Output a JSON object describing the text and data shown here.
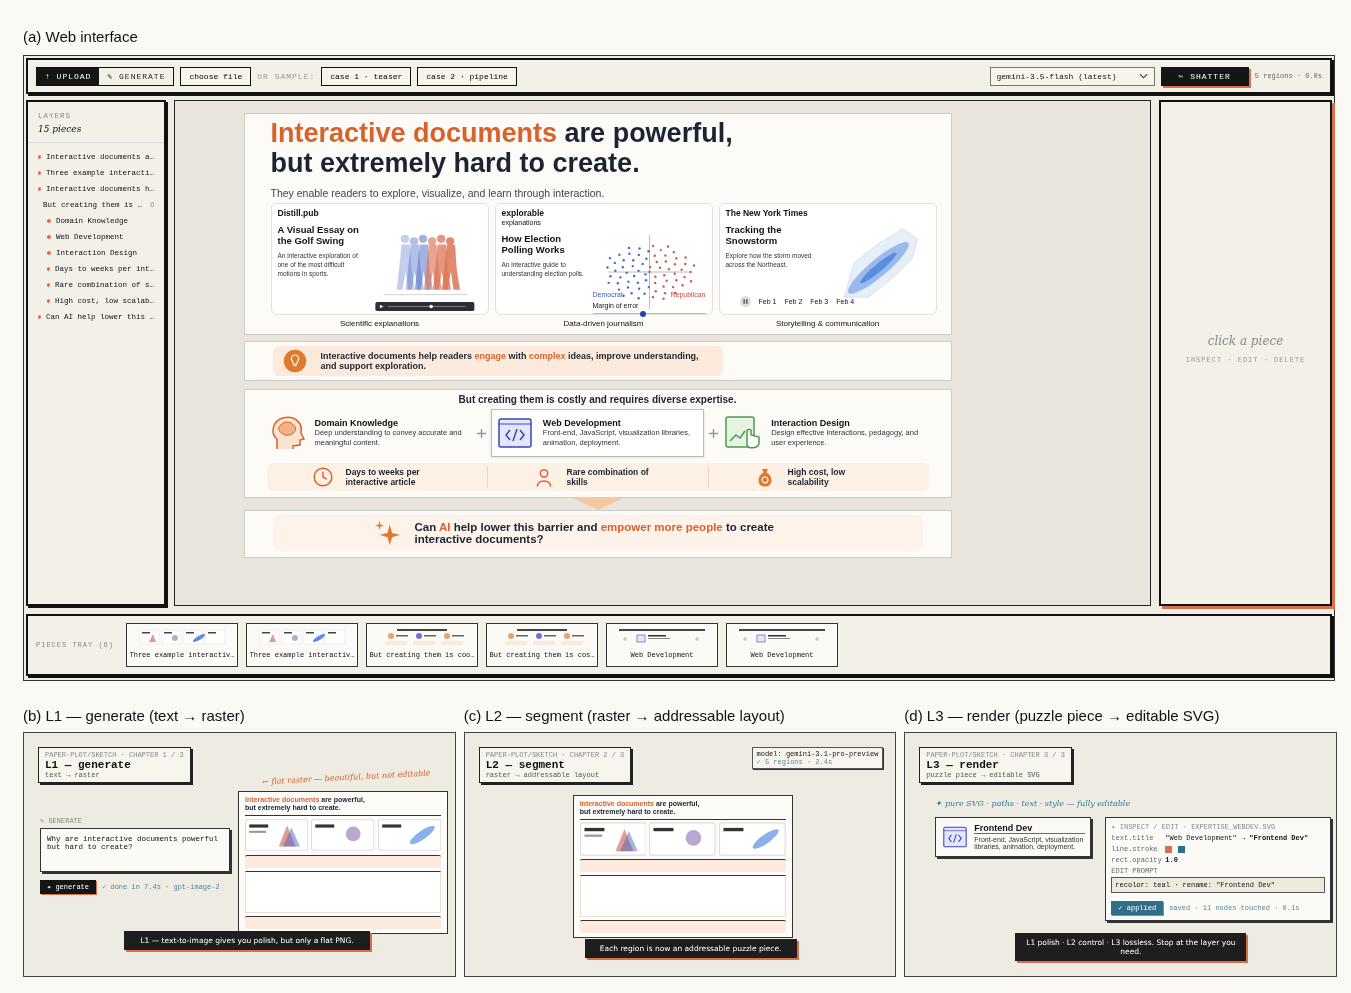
{
  "panel_a": {
    "caption": "(a) Web interface",
    "toolbar": {
      "modes": [
        {
          "label": "↑ UPLOAD",
          "selected": true
        },
        {
          "label": "✎ GENERATE",
          "selected": false
        }
      ],
      "file_button": "choose file",
      "sample_label": "OR SAMPLE:",
      "samples": [
        "case 1 · teaser",
        "case 2 · pipeline"
      ],
      "model_select": "gemini-3.5-flash (latest)",
      "shatter_button": "✂ SHATTER",
      "status": "5 regions · 0.0s"
    },
    "layers": {
      "title": "LAYERS",
      "count": "15 pieces",
      "items": [
        {
          "label": "Interactive documents a…"
        },
        {
          "label": "Three example interacti…"
        },
        {
          "label": "Interactive documents h…"
        },
        {
          "label": "But creating them is …",
          "badge": "6",
          "children": [
            {
              "label": "Domain Knowledge"
            },
            {
              "label": "Web Development"
            },
            {
              "label": "Interaction Design"
            },
            {
              "label": "Days to weeks per int…"
            },
            {
              "label": "Rare combination of s…"
            },
            {
              "label": "High cost, low scalab…"
            }
          ]
        },
        {
          "label": "Can AI help lower this …"
        }
      ]
    },
    "document": {
      "title_line1": [
        {
          "text": "Interactive documents",
          "accent": true
        },
        {
          "text": " are powerful,",
          "accent": false
        }
      ],
      "title_line2": "but extremely hard to create.",
      "subtitle": "They enable readers to explore, visualize, and learn through interaction.",
      "cards": [
        {
          "kind": "golf",
          "source": "Distill.pub",
          "title": "A Visual Essay on the Golf Swing",
          "desc": "An interactive exploration of one of the most difficult motions in sports.",
          "caption": "Scientific explanations"
        },
        {
          "kind": "poll",
          "source": "explorable",
          "source_sub": "explanations",
          "level": 0.45,
          "title": "How Election Polling Works",
          "desc": "An interactive guide to understanding election polls.",
          "labels": [
            "Democrat",
            "Republican",
            "Margin of error"
          ],
          "caption": "Data-driven journalism"
        },
        {
          "kind": "map",
          "source": "The New York Times",
          "title": "Tracking the Snowstorm",
          "desc": "Explore how the storm moved across the Northeast.",
          "labels": [
            "Feb 1",
            "Feb 2",
            "Feb 3",
            "Feb 4"
          ],
          "caption": "Storytelling & communication"
        }
      ],
      "engage": [
        {
          "text": "Interactive documents help readers ",
          "accent": false
        },
        {
          "text": "engage",
          "accent": true
        },
        {
          "text": " with ",
          "accent": false
        },
        {
          "text": "complex",
          "accent": true
        },
        {
          "text": " ideas, improve understanding, and support exploration.",
          "accent": false
        }
      ],
      "costs_heading": "But creating them is costly and requires diverse expertise.",
      "expertise": [
        {
          "kind": "brain",
          "title": "Domain Knowledge",
          "desc": "Deep understanding to convey accurate and meaningful content."
        },
        {
          "kind": "code",
          "title": "Web Development",
          "desc": "Front-end, JavaScript, visualization libraries, animation, deployment."
        },
        {
          "kind": "hand",
          "title": "Interaction Design",
          "desc": "Design effective interactions, pedagogy, and user experience."
        }
      ],
      "costs": [
        {
          "kind": "clock",
          "text": "Days to weeks per interactive article"
        },
        {
          "kind": "person",
          "text": "Rare combination of skills"
        },
        {
          "kind": "money",
          "text": "High cost, low scalability"
        }
      ],
      "question": [
        {
          "text": "Can ",
          "accent": false
        },
        {
          "text": "AI",
          "accent": true
        },
        {
          "text": " help lower this barrier and ",
          "accent": false
        },
        {
          "text": "empower more people",
          "accent": true
        },
        {
          "text": " to create interactive documents?",
          "accent": false
        }
      ]
    },
    "inspector": {
      "hint": "click a piece",
      "actions": "INSPECT · EDIT · DELETE"
    },
    "tray": {
      "label": "PIECES TRAY (6)",
      "pieces": [
        {
          "kind": "cards",
          "label": "Three example interactiv…"
        },
        {
          "kind": "cards",
          "label": "Three example interactiv…"
        },
        {
          "kind": "costs",
          "label": "But creating them is coo…"
        },
        {
          "kind": "costs",
          "label": "But creating them is cos…"
        },
        {
          "kind": "webdev",
          "label": "Web Development"
        },
        {
          "kind": "webdev",
          "label": "Web Development"
        }
      ]
    }
  },
  "panel_b": {
    "caption": "(b) L1 — generate (text → raster)",
    "chapter": {
      "kicker": "PAPER·PLOT/SKETCH · CHAPTER 1 / 3",
      "title": "L1 — generate",
      "sub": "text → raster"
    },
    "prompt_label": "✎ GENERATE",
    "prompt": "Why are interactive documents powerful but hard to create?",
    "button": "✦ generate",
    "status": "✓ done in 7.4s · gpt-image-2",
    "annotation": "← flat raster — beautiful, but not editable",
    "preview": {
      "title_line1": [
        {
          "text": "Interactive documents",
          "accent": true
        },
        {
          "text": " are powerful,",
          "accent": false
        }
      ],
      "title_line2": "but extremely hard to create."
    },
    "note": "L1 — text-to-image gives you polish, but only a flat PNG."
  },
  "panel_c": {
    "caption": "(c) L2 — segment (raster → addressable layout)",
    "chapter": {
      "kicker": "PAPER·PLOT/SKETCH · CHAPTER 2 / 3",
      "title": "L2 — segment",
      "sub": "raster → addressable layout"
    },
    "model_info": [
      "model: gemini-3.1-pro-preview",
      "✓ 5 regions · 2.4s"
    ],
    "preview": {
      "title_line1": [
        {
          "text": "Interactive documents",
          "accent": true
        },
        {
          "text": " are powerful,",
          "accent": false
        }
      ],
      "title_line2": "but extremely hard to create."
    },
    "note": "Each region is now an addressable puzzle piece."
  },
  "panel_d": {
    "caption": "(d) L3 — render (puzzle piece → editable SVG)",
    "chapter": {
      "kicker": "PAPER·PLOT/SKETCH · CHAPTER 3 / 3",
      "title": "L3 — render",
      "sub": "puzzle piece → editable SVG"
    },
    "annotation": "✦ pure SVG · paths · text · style — fully editable",
    "piece": {
      "title": "Frontend Dev",
      "desc": "Front-end, JavaScript, visualization libraries, animation, deployment."
    },
    "editor": {
      "header": "✦ INSPECT / EDIT · EXPERTISE_WEBDEV.SVG",
      "rows": [
        {
          "kind": "text",
          "key": "text.title",
          "value": "\"Web Development\" → **\"Frontend Dev\"**"
        },
        {
          "kind": "swatch",
          "key": "line.stroke"
        },
        {
          "kind": "text",
          "key": "rect.opacity",
          "value": "**1.0**"
        }
      ],
      "prompt_label": "EDIT PROMPT",
      "prompt": "recolor: teal · rename: \"Frontend Dev\"",
      "button": "✓ applied",
      "status": "saved · 11 nodes touched · 0.1s"
    },
    "note": "L1 polish · L2 control · L3 lossless. Stop at the layer you need."
  }
}
